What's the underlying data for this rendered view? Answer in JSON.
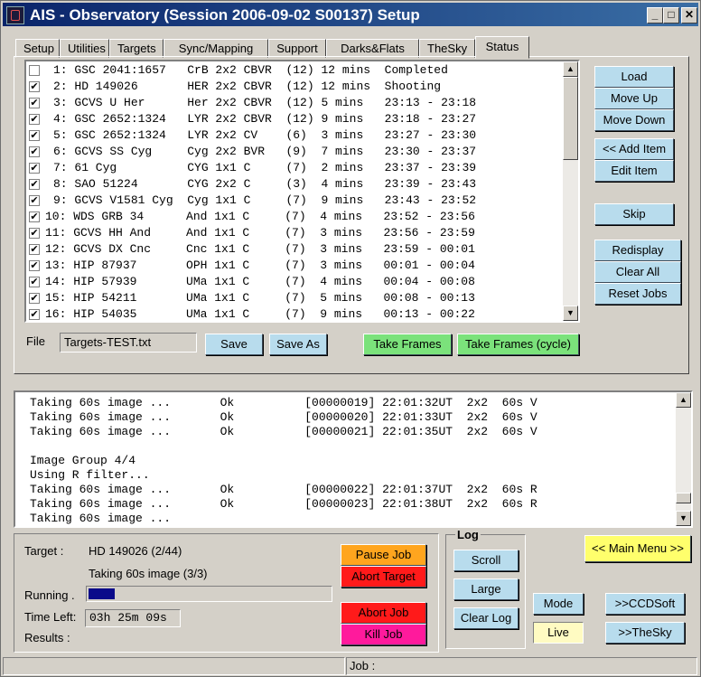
{
  "window": {
    "title": "AIS - Observatory (Session 2006-09-02 S00137) Setup",
    "controls": {
      "min": "_",
      "max": "□",
      "close": "✕"
    }
  },
  "tabs": [
    "Setup",
    "Utilities",
    "Targets",
    "Sync/Mapping",
    "Support",
    "Darks&Flats",
    "TheSky",
    "Status"
  ],
  "active_tab": "Status",
  "targets": [
    {
      "checked": false,
      "text": "1: GSC 2041:1657   CrB 2x2 CBVR  (12) 12 mins  Completed"
    },
    {
      "checked": true,
      "text": "2: HD 149026       HER 2x2 CBVR  (12) 12 mins  Shooting"
    },
    {
      "checked": true,
      "text": "3: GCVS U Her      Her 2x2 CBVR  (12) 5 mins   23:13 - 23:18"
    },
    {
      "checked": true,
      "text": "4: GSC 2652:1324   LYR 2x2 CBVR  (12) 9 mins   23:18 - 23:27"
    },
    {
      "checked": true,
      "text": "5: GSC 2652:1324   LYR 2x2 CV    (6)  3 mins   23:27 - 23:30"
    },
    {
      "checked": true,
      "text": "6: GCVS SS Cyg     Cyg 2x2 BVR   (9)  7 mins   23:30 - 23:37"
    },
    {
      "checked": true,
      "text": "7: 61 Cyg          CYG 1x1 C     (7)  2 mins   23:37 - 23:39"
    },
    {
      "checked": true,
      "text": "8: SAO 51224       CYG 2x2 C     (3)  4 mins   23:39 - 23:43"
    },
    {
      "checked": true,
      "text": "9: GCVS V1581 Cyg  Cyg 1x1 C     (7)  9 mins   23:43 - 23:52"
    },
    {
      "checked": true,
      "text": "10: WDS GRB 34      And 1x1 C     (7)  4 mins   23:52 - 23:56"
    },
    {
      "checked": true,
      "text": "11: GCVS HH And     And 1x1 C     (7)  3 mins   23:56 - 23:59"
    },
    {
      "checked": true,
      "text": "12: GCVS DX Cnc     Cnc 1x1 C     (7)  3 mins   23:59 - 00:01"
    },
    {
      "checked": true,
      "text": "13: HIP 87937       OPH 1x1 C     (7)  3 mins   00:01 - 00:04"
    },
    {
      "checked": true,
      "text": "14: HIP 57939       UMa 1x1 C     (7)  4 mins   00:04 - 00:08"
    },
    {
      "checked": true,
      "text": "15: HIP 54211       UMa 1x1 C     (7)  5 mins   00:08 - 00:13"
    },
    {
      "checked": true,
      "text": "16: HIP 54035       UMa 1x1 C     (7)  9 mins   00:13 - 00:22"
    }
  ],
  "side_buttons": {
    "load": "Load",
    "move_up": "Move Up",
    "move_down": "Move Down",
    "add_item": "<< Add Item",
    "edit_item": "Edit Item",
    "skip": "Skip",
    "redisplay": "Redisplay",
    "clear_all": "Clear All",
    "reset_jobs": "Reset Jobs"
  },
  "file": {
    "label": "File",
    "value": "Targets-TEST.txt",
    "save": "Save",
    "save_as": "Save As",
    "take_frames": "Take Frames",
    "take_frames_cycle": "Take Frames (cycle)"
  },
  "log_lines": [
    "Taking 60s image ...       Ok          [00000019] 22:01:32UT  2x2  60s V",
    "Taking 60s image ...       Ok          [00000020] 22:01:33UT  2x2  60s V",
    "Taking 60s image ...       Ok          [00000021] 22:01:35UT  2x2  60s V",
    "",
    "Image Group 4/4",
    "Using R filter...",
    "Taking 60s image ...       Ok          [00000022] 22:01:37UT  2x2  60s R",
    "Taking 60s image ...       Ok          [00000023] 22:01:38UT  2x2  60s R",
    "Taking 60s image ..."
  ],
  "status": {
    "target_label": "Target :",
    "target_value": "HD 149026 (2/44)",
    "activity": "Taking 60s image (3/3)",
    "running_label": "Running .",
    "running_progress": 0.11,
    "time_left_label": "Time Left:",
    "time_left_value": "03h 25m 09s",
    "results_label": "Results :"
  },
  "job_buttons": {
    "pause_job": "Pause Job",
    "abort_target": "Abort Target",
    "abort_job": "Abort Job",
    "kill_job": "Kill Job"
  },
  "log_group": {
    "title": "Log",
    "scroll": "Scroll",
    "large": "Large",
    "clear_log": "Clear Log"
  },
  "right_buttons": {
    "main_menu": "<< Main Menu >>",
    "mode": "Mode",
    "live": "Live",
    "ccdsoft": ">>CCDSoft",
    "thesky": ">>TheSky"
  },
  "statusbar": {
    "job_label": "Job :"
  },
  "colors": {
    "button": "#b8dced",
    "green": "#7be27b",
    "orange": "#ffa51e",
    "red": "#ff1a1a",
    "pink": "#ff1a9c",
    "yellow": "#ffff6c",
    "progress": "#0a0a8a"
  }
}
